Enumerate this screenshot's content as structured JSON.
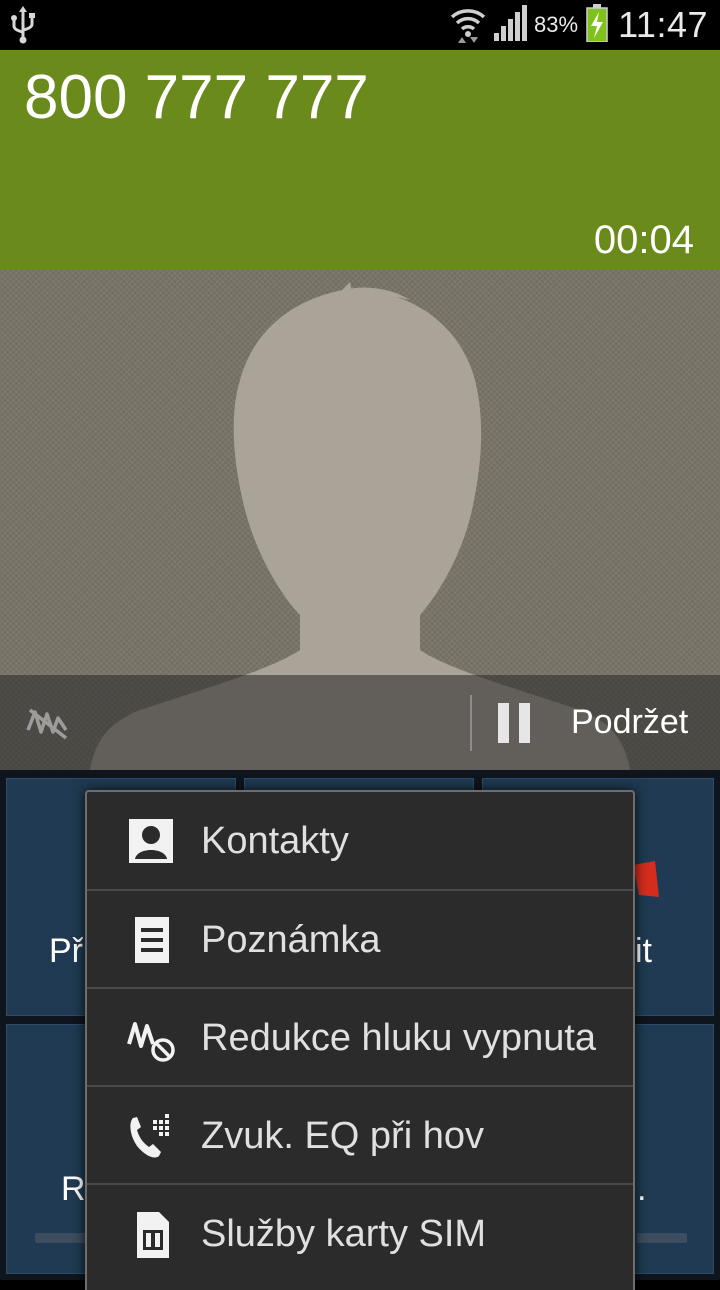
{
  "status_bar": {
    "battery_percent": "83%",
    "time": "11:47",
    "icons": [
      "usb-icon",
      "wifi-icon",
      "signal-icon",
      "battery-charging-icon"
    ]
  },
  "call": {
    "number": "800 777 777",
    "timer": "00:04",
    "header_color": "#6b8a1c"
  },
  "hold_bar": {
    "noise_reduction_icon": "noise-reduction-off-icon",
    "hold_label": "Podržet"
  },
  "background_buttons": {
    "left_top_partial": "Př",
    "right_top_partial": "it",
    "left_bottom_partial": "R",
    "right_bottom_partial": "."
  },
  "menu": {
    "items": [
      {
        "label": "Kontakty",
        "icon": "contact-icon"
      },
      {
        "label": "Poznámka",
        "icon": "memo-icon"
      },
      {
        "label": "Redukce hluku vypnuta",
        "icon": "noise-reduction-icon"
      },
      {
        "label": "Zvuk. EQ při hov",
        "icon": "call-eq-icon"
      },
      {
        "label": "Služby karty SIM",
        "icon": "sim-card-icon"
      }
    ]
  }
}
